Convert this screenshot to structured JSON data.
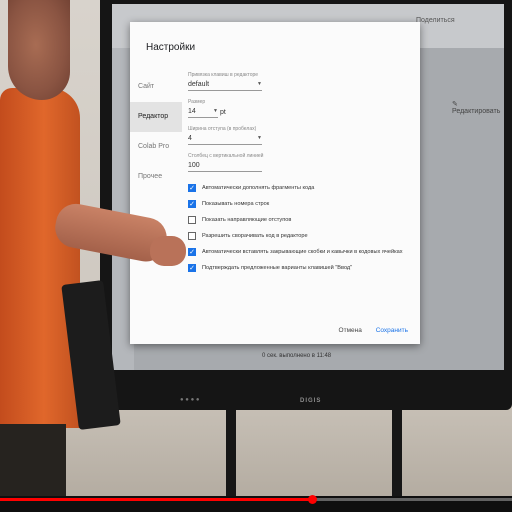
{
  "dialog": {
    "title": "Настройки",
    "nav": [
      {
        "label": "Сайт",
        "active": false
      },
      {
        "label": "Редактор",
        "active": true
      },
      {
        "label": "Colab Pro",
        "active": false
      },
      {
        "label": "Прочее",
        "active": false
      }
    ],
    "editor": {
      "key_bindings": {
        "label": "Привязка клавиш в редакторе",
        "value": "default"
      },
      "font_size": {
        "label": "Размер",
        "value": "14",
        "unit": "pt"
      },
      "indent_width": {
        "label": "Ширина отступа (в пробелах)",
        "value": "4"
      },
      "vertical_ruler": {
        "label": "Столбец с вертикальной линией",
        "value": "100"
      },
      "checkboxes": [
        {
          "label": "Автоматически дополнять фрагменты кода",
          "checked": true
        },
        {
          "label": "Показывать номера строк",
          "checked": true
        },
        {
          "label": "Показать направляющие отступов",
          "checked": false
        },
        {
          "label": "Разрешить сворачивать код в редакторе",
          "checked": false
        },
        {
          "label": "Автоматически вставлять закрывающие скобки и кавычки в кодовых ячейках",
          "checked": true
        },
        {
          "label": "Подтверждать предложенные варианты клавишей \"Ввод\"",
          "checked": true
        }
      ]
    },
    "actions": {
      "cancel": "Отмена",
      "save": "Сохранить"
    }
  },
  "background": {
    "share": "Поделиться",
    "edit": "Редактировать",
    "status": "0 сек.  выполнено в 11:48",
    "brand": "DIGIS"
  },
  "video": {
    "progress": 0.61
  },
  "colors": {
    "checkbox": "#1a73e8",
    "progress": "#ff0000",
    "shirt": "#e0672b"
  }
}
